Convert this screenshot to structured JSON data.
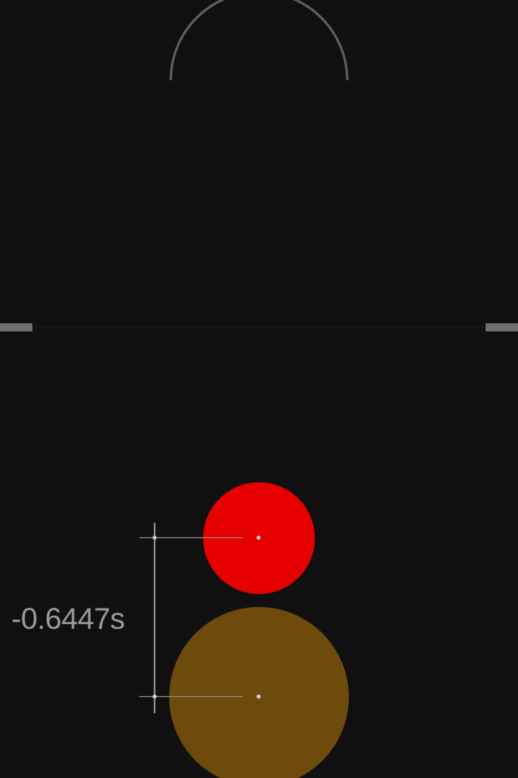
{
  "target_arc": {
    "icon": "target-arc-icon",
    "color": "#5e5e5e"
  },
  "divider": {
    "handle_color": "#6f6f70",
    "line_color": "#1f1f20"
  },
  "balls": {
    "red": {
      "color": "#e60000"
    },
    "brown": {
      "color": "#6e4a0c"
    }
  },
  "measurement": {
    "offset_text": "-0.6447s",
    "line_color": "#bdbdbd"
  }
}
